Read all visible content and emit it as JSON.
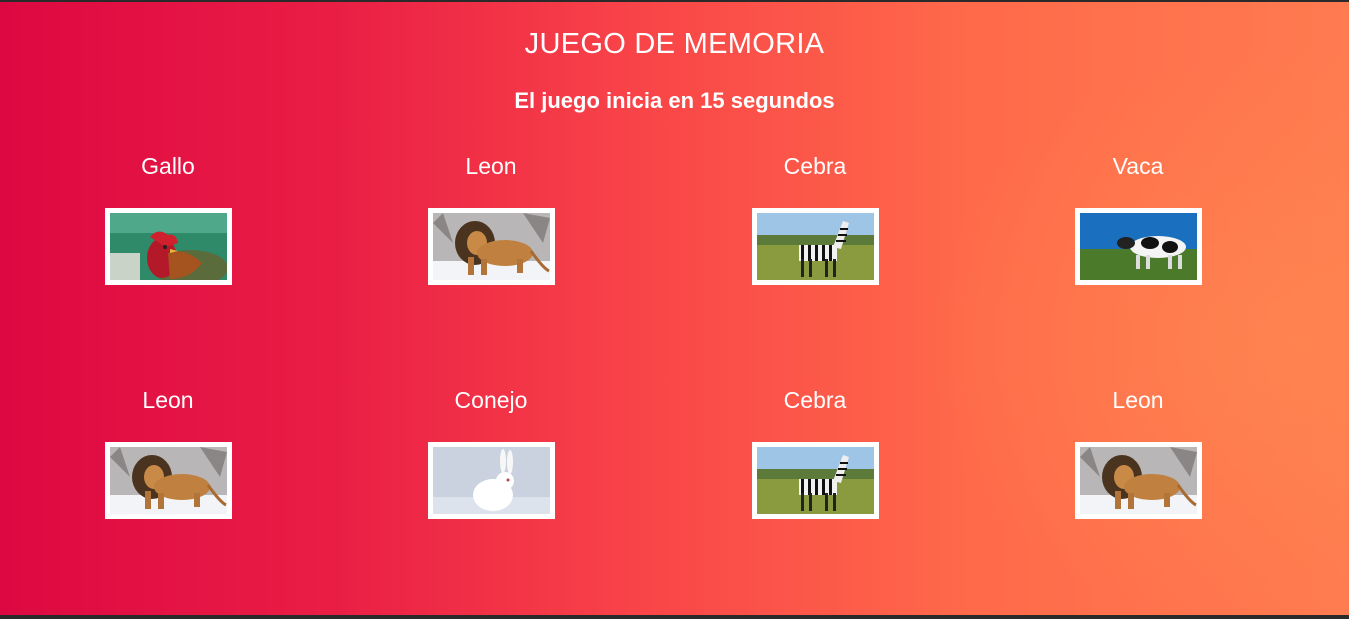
{
  "title": "JUEGO DE MEMORIA",
  "countdown": "El juego inicia en 15 segundos",
  "cards": [
    {
      "label": "Gallo",
      "image": "rooster-image"
    },
    {
      "label": "Leon",
      "image": "lion-image"
    },
    {
      "label": "Cebra",
      "image": "zebra-image"
    },
    {
      "label": "Vaca",
      "image": "cow-image"
    },
    {
      "label": "Leon",
      "image": "lion-image"
    },
    {
      "label": "Conejo",
      "image": "rabbit-image"
    },
    {
      "label": "Cebra",
      "image": "zebra-image"
    },
    {
      "label": "Leon",
      "image": "lion-image"
    }
  ],
  "colors": {
    "gradient_start": "#dd0842",
    "gradient_end": "#ff7b50",
    "text": "#ffffff"
  }
}
